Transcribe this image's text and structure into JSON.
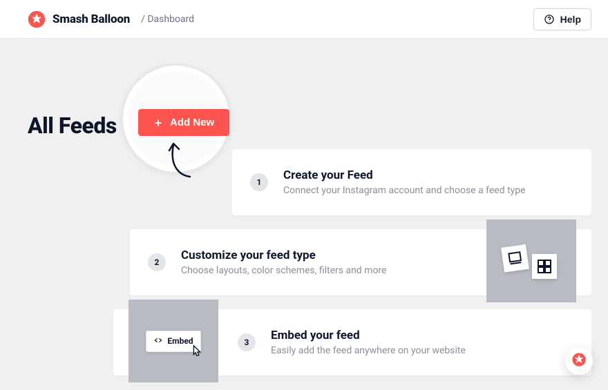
{
  "header": {
    "brand_name": "Smash Balloon",
    "breadcrumb": "/ Dashboard",
    "help_label": "Help"
  },
  "page": {
    "title": "All Feeds",
    "add_button_label": "Add New",
    "accent_color": "#fe544f"
  },
  "steps": [
    {
      "num": "1",
      "title": "Create your Feed",
      "desc": "Connect your Instagram account and choose a feed type"
    },
    {
      "num": "2",
      "title": "Customize your feed type",
      "desc": "Choose layouts, color schemes, filters and more"
    },
    {
      "num": "3",
      "title": "Embed your feed",
      "desc": "Easily add the feed anywhere on your website"
    }
  ],
  "embed_chip": {
    "label": "Embed"
  }
}
